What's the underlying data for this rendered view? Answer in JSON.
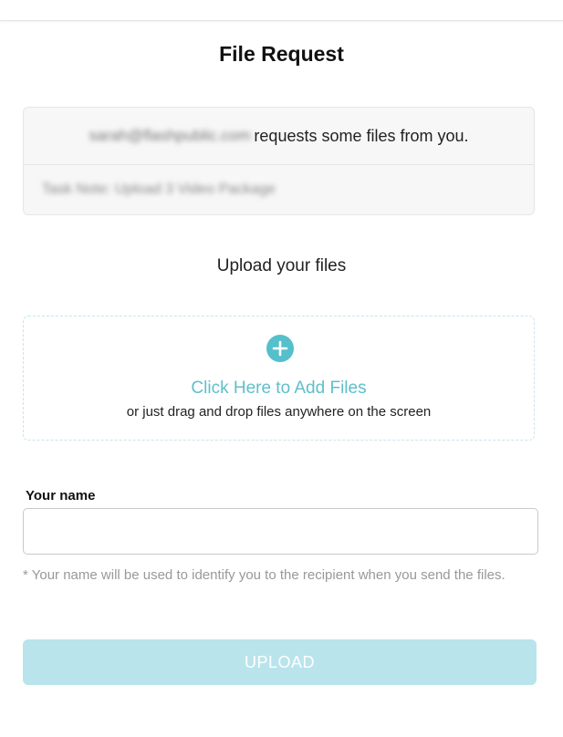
{
  "page": {
    "title": "File Request"
  },
  "request": {
    "sender_email": "sarah@flashpublic.com",
    "message": "requests some files from you.",
    "note": "Task Note: Upload 3 Video Package"
  },
  "upload": {
    "heading": "Upload your files",
    "add_files_label": "Click Here to Add Files",
    "drag_hint": "or just drag and drop files anywhere on the screen"
  },
  "form": {
    "name_label": "Your name",
    "name_value": "",
    "name_placeholder": "",
    "name_hint": "* Your name will be used to identify you to the recipient when you send the files.",
    "upload_button_label": "UPLOAD"
  },
  "colors": {
    "accent": "#55bfcc",
    "button_disabled": "#b9e4ec",
    "dropzone_border": "#c8e6ec",
    "card_background": "#f7f7f7"
  },
  "icons": {
    "add": "plus-circle-icon"
  }
}
